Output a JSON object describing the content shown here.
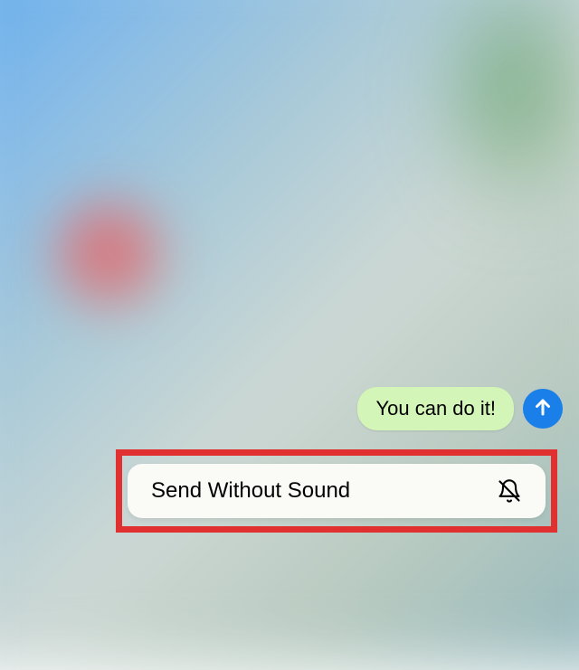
{
  "message": {
    "text": "You can do it!"
  },
  "send_option": {
    "label": "Send Without Sound"
  },
  "colors": {
    "bubble_bg": "#d4f5b8",
    "send_btn": "#1a7fe8",
    "highlight": "#e03030"
  }
}
